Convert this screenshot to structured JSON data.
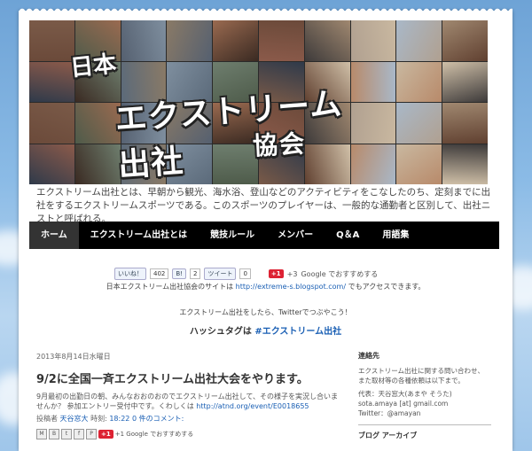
{
  "header": {
    "title_line1": "日本",
    "title_line2": "エクストリーム出社",
    "title_line3": "協会"
  },
  "description": "エクストリーム出社とは、早朝から観光、海水浴、登山などのアクティビティをこなしたのち、定刻までに出社をするエクストリームスポーツである。このスポーツのプレイヤーは、一般的な通勤者と区別して、出社ニストと呼ばれる。",
  "nav": {
    "items": [
      {
        "label": "ホーム",
        "active": true
      },
      {
        "label": "エクストリーム出社とは",
        "active": false
      },
      {
        "label": "競技ルール",
        "active": false
      },
      {
        "label": "メンバー",
        "active": false
      },
      {
        "label": "Q＆A",
        "active": false
      },
      {
        "label": "用語集",
        "active": false
      }
    ]
  },
  "social": {
    "like_label": "いいね！",
    "like_count": "402",
    "hatena_count": "2",
    "tweet_label": "ツイート",
    "tweet_count": "0",
    "gplus_label": "+1",
    "gplus_count": "+3",
    "gplus_text": "Google でおすすめする"
  },
  "notice": {
    "prefix": "日本エクストリーム出社協会のサイトは",
    "url": "http://extreme-s.blogspot.com/",
    "suffix": "でもアクセスできます。"
  },
  "twitter": {
    "line1": "エクストリーム出社をしたら、Twitterでつぶやこう！",
    "hashtag_prefix": "ハッシュタグは",
    "hashtag": "#エクストリーム出社"
  },
  "post": {
    "date": "2013年8月14日水曜日",
    "title": "9/2に全国一斉エクストリーム出社大会をやります。",
    "body": "9月最初の出勤日の朝、みんなおおのおのでエクストリーム出社して、その様子を実況し合いませんか？ 参加エントリー受付中です。くわしくは",
    "body_link": "http://atnd.org/event/E0018655",
    "meta_author_label": "投稿者",
    "meta_author": "天谷窓大",
    "meta_time_label": "時刻:",
    "meta_time": "18:22",
    "meta_comments": "0 件のコメント:",
    "share_gplus": "+1",
    "share_text": "+1   Google でおすすめする"
  },
  "sidebar": {
    "contact_heading": "連絡先",
    "contact_text1": "エクストリーム出社に関する問い合わせ、",
    "contact_text2": "また取材等の各種依頼は以下まで。",
    "rep": "代表：天谷窓大(あまや そうた)",
    "email": "sota.amaya [at] gmail.com",
    "twitter": "Twitter：@amayan",
    "archive_heading": "ブログ アーカイブ"
  },
  "colors": {
    "nav_bg": "#000000",
    "nav_active": "#333333",
    "link": "#1a5fb4"
  }
}
